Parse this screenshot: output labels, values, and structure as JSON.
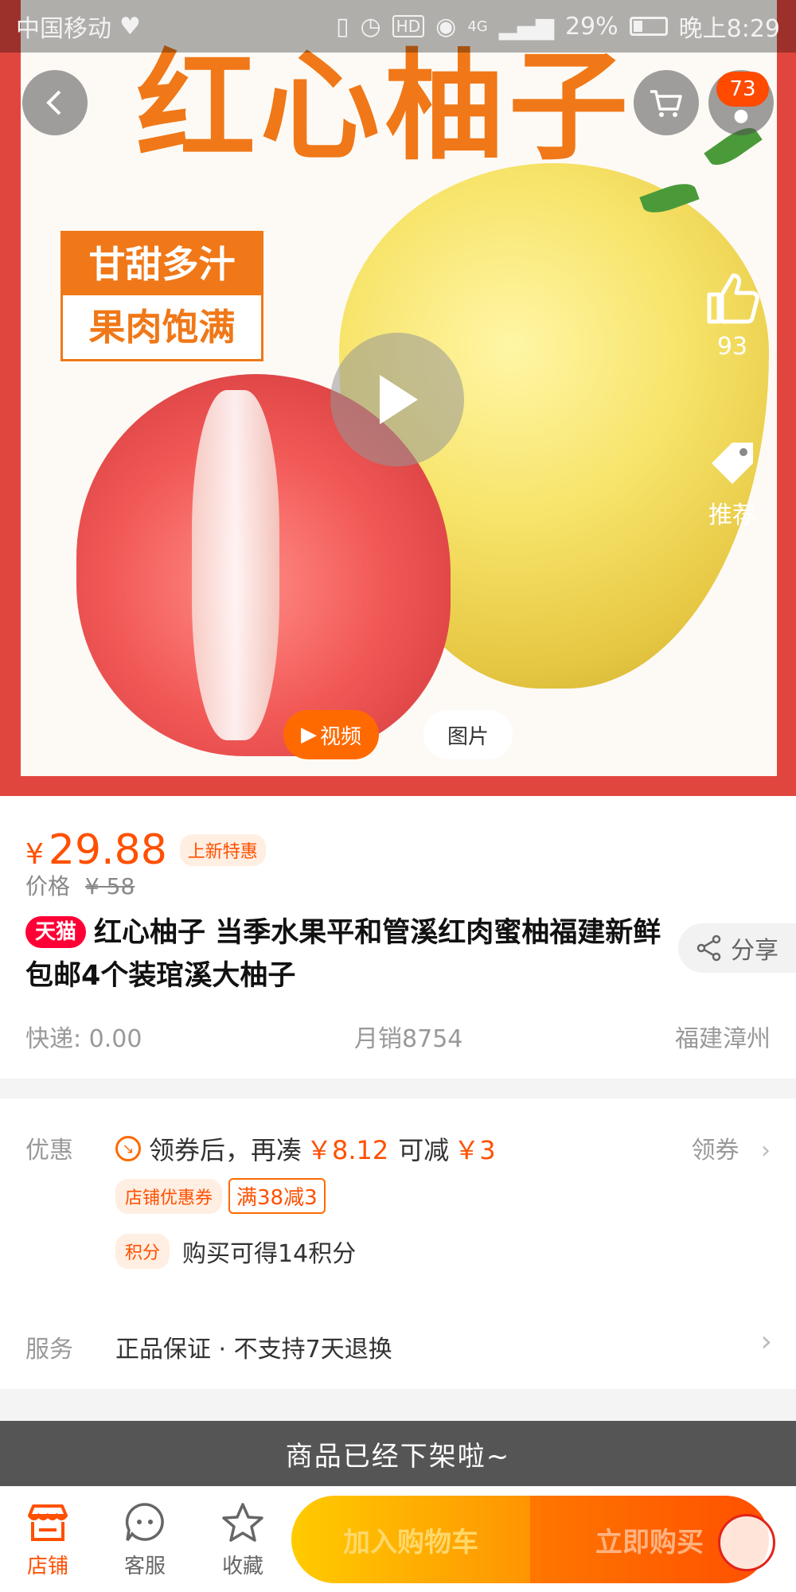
{
  "status_bar": {
    "carrier": "中国移动",
    "hd": "HD",
    "network": "4G",
    "battery": "29%",
    "battery_level": 0.29,
    "time": "晚上8:29"
  },
  "hero": {
    "title": "红心柚子",
    "tag_line1": "甘甜多汁",
    "tag_line2": "果肉饱满",
    "cart_count": "73",
    "like_count": "93",
    "recommend_label": "推荐",
    "media_tabs": [
      "视频",
      "图片"
    ],
    "active_media_tab": "视频"
  },
  "product": {
    "currency": "¥",
    "price": "29.88",
    "promo_tag": "上新特惠",
    "original_price_label": "价格",
    "original_price": "¥ 58",
    "platform_tag": "天猫",
    "title": "红心柚子 当季水果平和管溪红肉蜜柚福建新鲜包邮4个装琯溪大柚子",
    "share_label": "分享",
    "shipping": "快递: 0.00",
    "monthly_sales": "月销8754",
    "location": "福建漳州"
  },
  "offers": {
    "label": "优惠",
    "coupon_text_a": "领券后，再凑",
    "coupon_amount": "￥8.12",
    "coupon_text_b": "可减",
    "coupon_discount": "￥3",
    "get_coupon": "领券",
    "store_coupon_tag": "店铺优惠券",
    "store_coupon_value": "满38减3",
    "points_tag": "积分",
    "points_text": "购买可得14积分"
  },
  "service": {
    "label": "服务",
    "text": "正品保证 · 不支持7天退换"
  },
  "banner": {
    "text": "商品已经下架啦~"
  },
  "bottom_bar": {
    "shop": "店铺",
    "customer_service": "客服",
    "favorite": "收藏",
    "add_to_cart": "加入购物车",
    "buy_now": "立即购买"
  },
  "colors": {
    "accent": "#ff5000",
    "tmall_red": "#ff0036",
    "hero_border": "#e0463e"
  }
}
